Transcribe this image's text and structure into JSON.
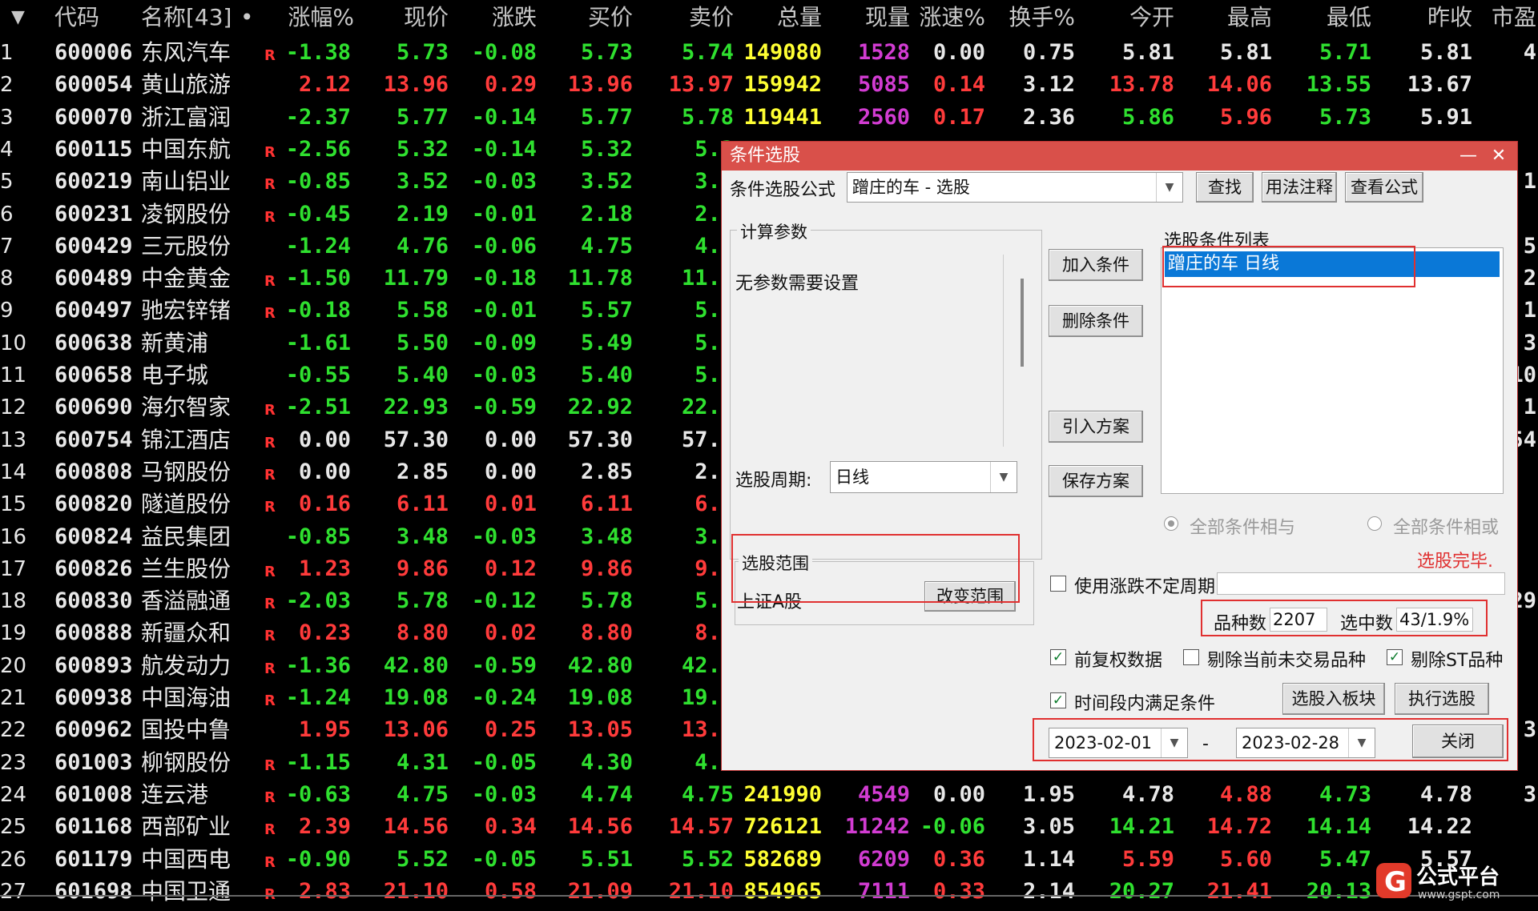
{
  "table": {
    "headers": [
      "代码",
      "名称[43]",
      "•",
      "涨幅%",
      "现价",
      "涨跌",
      "买价",
      "卖价",
      "总量",
      "现量",
      "涨速%",
      "换手%",
      "今开",
      "最高",
      "最低",
      "昨收",
      "市盈"
    ],
    "rows": [
      {
        "idx": "1",
        "code": "600006",
        "name": "东风汽车",
        "r": "R",
        "chg": "-1.38",
        "price": "5.73",
        "diff": "-0.08",
        "bid": "5.73",
        "ask": "5.74",
        "vol": "149080",
        "cur": "1528",
        "speed": "0.00",
        "turn": "0.75",
        "open": "5.81",
        "high": "5.81",
        "low": "5.71",
        "prev": "5.81",
        "pe": "4"
      },
      {
        "idx": "2",
        "code": "600054",
        "name": "黄山旅游",
        "r": "",
        "chg": "2.12",
        "price": "13.96",
        "diff": "0.29",
        "bid": "13.96",
        "ask": "13.97",
        "vol": "159942",
        "cur": "5085",
        "speed": "0.14",
        "turn": "3.12",
        "open": "13.78",
        "high": "14.06",
        "low": "13.55",
        "prev": "13.67",
        "pe": ""
      },
      {
        "idx": "3",
        "code": "600070",
        "name": "浙江富润",
        "r": "",
        "chg": "-2.37",
        "price": "5.77",
        "diff": "-0.14",
        "bid": "5.77",
        "ask": "5.78",
        "vol": "119441",
        "cur": "2560",
        "speed": "0.17",
        "turn": "2.36",
        "open": "5.86",
        "high": "5.96",
        "low": "5.73",
        "prev": "5.91",
        "pe": ""
      },
      {
        "idx": "4",
        "code": "600115",
        "name": "中国东航",
        "r": "R",
        "chg": "-2.56",
        "price": "5.32",
        "diff": "-0.14",
        "bid": "5.32",
        "ask": "5.3",
        "vol": "",
        "cur": "",
        "speed": "",
        "turn": "",
        "open": "",
        "high": "",
        "low": "",
        "prev": "",
        "pe": ""
      },
      {
        "idx": "5",
        "code": "600219",
        "name": "南山铝业",
        "r": "R",
        "chg": "-0.85",
        "price": "3.52",
        "diff": "-0.03",
        "bid": "3.52",
        "ask": "3.5",
        "vol": "",
        "cur": "",
        "speed": "",
        "turn": "",
        "open": "",
        "high": "",
        "low": "",
        "prev": "",
        "pe": "1"
      },
      {
        "idx": "6",
        "code": "600231",
        "name": "凌钢股份",
        "r": "R",
        "chg": "-0.45",
        "price": "2.19",
        "diff": "-0.01",
        "bid": "2.18",
        "ask": "2.1",
        "vol": "",
        "cur": "",
        "speed": "",
        "turn": "",
        "open": "",
        "high": "",
        "low": "",
        "prev": "",
        "pe": ""
      },
      {
        "idx": "7",
        "code": "600429",
        "name": "三元股份",
        "r": "",
        "chg": "-1.24",
        "price": "4.76",
        "diff": "-0.06",
        "bid": "4.75",
        "ask": "4.7",
        "vol": "",
        "cur": "",
        "speed": "",
        "turn": "",
        "open": "",
        "high": "",
        "low": "",
        "prev": "",
        "pe": "5"
      },
      {
        "idx": "8",
        "code": "600489",
        "name": "中金黄金",
        "r": "R",
        "chg": "-1.50",
        "price": "11.79",
        "diff": "-0.18",
        "bid": "11.78",
        "ask": "11.7",
        "vol": "",
        "cur": "",
        "speed": "",
        "turn": "",
        "open": "",
        "high": "",
        "low": "",
        "prev": "",
        "pe": "2"
      },
      {
        "idx": "9",
        "code": "600497",
        "name": "驰宏锌锗",
        "r": "R",
        "chg": "-0.18",
        "price": "5.58",
        "diff": "-0.01",
        "bid": "5.57",
        "ask": "5.5",
        "vol": "",
        "cur": "",
        "speed": "",
        "turn": "",
        "open": "",
        "high": "",
        "low": "",
        "prev": "",
        "pe": "1"
      },
      {
        "idx": "10",
        "code": "600638",
        "name": "新黄浦",
        "r": "",
        "chg": "-1.61",
        "price": "5.50",
        "diff": "-0.09",
        "bid": "5.49",
        "ask": "5.5",
        "vol": "",
        "cur": "",
        "speed": "",
        "turn": "",
        "open": "",
        "high": "",
        "low": "",
        "prev": "",
        "pe": "3"
      },
      {
        "idx": "11",
        "code": "600658",
        "name": "电子城",
        "r": "",
        "chg": "-0.55",
        "price": "5.40",
        "diff": "-0.03",
        "bid": "5.40",
        "ask": "5.4",
        "vol": "",
        "cur": "",
        "speed": "",
        "turn": "",
        "open": "",
        "high": "",
        "low": "",
        "prev": "",
        "pe": "10"
      },
      {
        "idx": "12",
        "code": "600690",
        "name": "海尔智家",
        "r": "R",
        "chg": "-2.51",
        "price": "22.93",
        "diff": "-0.59",
        "bid": "22.92",
        "ask": "22.9",
        "vol": "",
        "cur": "",
        "speed": "",
        "turn": "",
        "open": "",
        "high": "",
        "low": "",
        "prev": "",
        "pe": "1"
      },
      {
        "idx": "13",
        "code": "600754",
        "name": "锦江酒店",
        "r": "R",
        "chg": "0.00",
        "price": "57.30",
        "diff": "0.00",
        "bid": "57.30",
        "ask": "57.3",
        "vol": "",
        "cur": "",
        "speed": "",
        "turn": "",
        "open": "",
        "high": "",
        "low": "",
        "prev": "",
        "pe": "54"
      },
      {
        "idx": "14",
        "code": "600808",
        "name": "马钢股份",
        "r": "R",
        "chg": "0.00",
        "price": "2.85",
        "diff": "0.00",
        "bid": "2.85",
        "ask": "2.8",
        "vol": "",
        "cur": "",
        "speed": "",
        "turn": "",
        "open": "",
        "high": "",
        "low": "",
        "prev": "",
        "pe": ""
      },
      {
        "idx": "15",
        "code": "600820",
        "name": "隧道股份",
        "r": "R",
        "chg": "0.16",
        "price": "6.11",
        "diff": "0.01",
        "bid": "6.11",
        "ask": "6.1",
        "vol": "",
        "cur": "",
        "speed": "",
        "turn": "",
        "open": "",
        "high": "",
        "low": "",
        "prev": "",
        "pe": ""
      },
      {
        "idx": "16",
        "code": "600824",
        "name": "益民集团",
        "r": "",
        "chg": "-0.85",
        "price": "3.48",
        "diff": "-0.03",
        "bid": "3.48",
        "ask": "3.4",
        "vol": "",
        "cur": "",
        "speed": "",
        "turn": "",
        "open": "",
        "high": "",
        "low": "",
        "prev": "",
        "pe": ""
      },
      {
        "idx": "17",
        "code": "600826",
        "name": "兰生股份",
        "r": "R",
        "chg": "1.23",
        "price": "9.86",
        "diff": "0.12",
        "bid": "9.86",
        "ask": "9.8",
        "vol": "",
        "cur": "",
        "speed": "",
        "turn": "",
        "open": "",
        "high": "",
        "low": "",
        "prev": "",
        "pe": ""
      },
      {
        "idx": "18",
        "code": "600830",
        "name": "香溢融通",
        "r": "R",
        "chg": "-2.03",
        "price": "5.78",
        "diff": "-0.12",
        "bid": "5.78",
        "ask": "5.7",
        "vol": "",
        "cur": "",
        "speed": "",
        "turn": "",
        "open": "",
        "high": "",
        "low": "",
        "prev": "",
        "pe": "29"
      },
      {
        "idx": "19",
        "code": "600888",
        "name": "新疆众和",
        "r": "R",
        "chg": "0.23",
        "price": "8.80",
        "diff": "0.02",
        "bid": "8.80",
        "ask": "8.8",
        "vol": "",
        "cur": "",
        "speed": "",
        "turn": "",
        "open": "",
        "high": "",
        "low": "",
        "prev": "",
        "pe": ""
      },
      {
        "idx": "20",
        "code": "600893",
        "name": "航发动力",
        "r": "R",
        "chg": "-1.36",
        "price": "42.80",
        "diff": "-0.59",
        "bid": "42.80",
        "ask": "42.8",
        "vol": "",
        "cur": "",
        "speed": "",
        "turn": "",
        "open": "",
        "high": "",
        "low": "",
        "prev": "",
        "pe": ""
      },
      {
        "idx": "21",
        "code": "600938",
        "name": "中国海油",
        "r": "R",
        "chg": "-1.24",
        "price": "19.08",
        "diff": "-0.24",
        "bid": "19.08",
        "ask": "19.0",
        "vol": "",
        "cur": "",
        "speed": "",
        "turn": "",
        "open": "",
        "high": "",
        "low": "",
        "prev": "",
        "pe": ""
      },
      {
        "idx": "22",
        "code": "600962",
        "name": "国投中鲁",
        "r": "",
        "chg": "1.95",
        "price": "13.06",
        "diff": "0.25",
        "bid": "13.05",
        "ask": "13.0",
        "vol": "",
        "cur": "",
        "speed": "",
        "turn": "",
        "open": "",
        "high": "",
        "low": "",
        "prev": "",
        "pe": "3"
      },
      {
        "idx": "23",
        "code": "601003",
        "name": "柳钢股份",
        "r": "R",
        "chg": "-1.15",
        "price": "4.31",
        "diff": "-0.05",
        "bid": "4.30",
        "ask": "4.3",
        "vol": "",
        "cur": "",
        "speed": "",
        "turn": "",
        "open": "",
        "high": "",
        "low": "",
        "prev": "",
        "pe": ""
      },
      {
        "idx": "24",
        "code": "601008",
        "name": "连云港",
        "r": "R",
        "chg": "-0.63",
        "price": "4.75",
        "diff": "-0.03",
        "bid": "4.74",
        "ask": "4.75",
        "vol": "241990",
        "cur": "4549",
        "speed": "0.00",
        "turn": "1.95",
        "open": "4.78",
        "high": "4.88",
        "low": "4.73",
        "prev": "4.78",
        "pe": "3"
      },
      {
        "idx": "25",
        "code": "601168",
        "name": "西部矿业",
        "r": "R",
        "chg": "2.39",
        "price": "14.56",
        "diff": "0.34",
        "bid": "14.56",
        "ask": "14.57",
        "vol": "726121",
        "cur": "11242",
        "speed": "-0.06",
        "turn": "3.05",
        "open": "14.21",
        "high": "14.72",
        "low": "14.14",
        "prev": "14.22",
        "pe": ""
      },
      {
        "idx": "26",
        "code": "601179",
        "name": "中国西电",
        "r": "R",
        "chg": "-0.90",
        "price": "5.52",
        "diff": "-0.05",
        "bid": "5.51",
        "ask": "5.52",
        "vol": "582689",
        "cur": "6209",
        "speed": "0.36",
        "turn": "1.14",
        "open": "5.59",
        "high": "5.60",
        "low": "5.47",
        "prev": "5.57",
        "pe": ""
      },
      {
        "idx": "27",
        "code": "601698",
        "name": "中国卫通",
        "r": "R",
        "chg": "2.83",
        "price": "21.10",
        "diff": "0.58",
        "bid": "21.09",
        "ask": "21.10",
        "vol": "854965",
        "cur": "7111",
        "speed": "0.33",
        "turn": "2.14",
        "open": "20.27",
        "high": "21.41",
        "low": "20.13",
        "prev": "",
        "pe": ""
      }
    ]
  },
  "dialog": {
    "title": "条件选股",
    "formula_label": "条件选股公式",
    "formula_value": "蹭庄的车  -  选股",
    "btn_find": "查找",
    "btn_usage": "用法注释",
    "btn_view": "查看公式",
    "params_title": "计算参数",
    "params_text": "无参数需要设置",
    "period_label": "选股周期:",
    "period_value": "日线",
    "range_title": "选股范围",
    "range_value": "上证A股",
    "btn_change_range": "改变范围",
    "btn_add": "加入条件",
    "btn_delete": "删除条件",
    "btn_import": "引入方案",
    "btn_save": "保存方案",
    "cond_list_title": "选股条件列表",
    "cond_items": [
      "蹭庄的车  日线"
    ],
    "radio_and": "全部条件相与",
    "radio_or": "全部条件相或",
    "status": "选股完毕.",
    "chk_uncertain": "使用涨跌不定周期",
    "count_label": "品种数",
    "count_value": "2207",
    "selected_label": "选中数",
    "selected_value": "43/1.9%",
    "chk_fq": "前复权数据",
    "chk_notrade": "剔除当前未交易品种",
    "chk_st": "剔除ST品种",
    "chk_timerange": "时间段内满足条件",
    "btn_to_block": "选股入板块",
    "btn_execute": "执行选股",
    "date_from": "2023-02-01",
    "date_sep": "-",
    "date_to": "2023-02-28",
    "btn_close": "关闭"
  },
  "colors": {
    "up": "#ff3b3b",
    "down": "#2fe02f",
    "title_bar": "#d9504a",
    "highlight": "#0a78d7"
  }
}
